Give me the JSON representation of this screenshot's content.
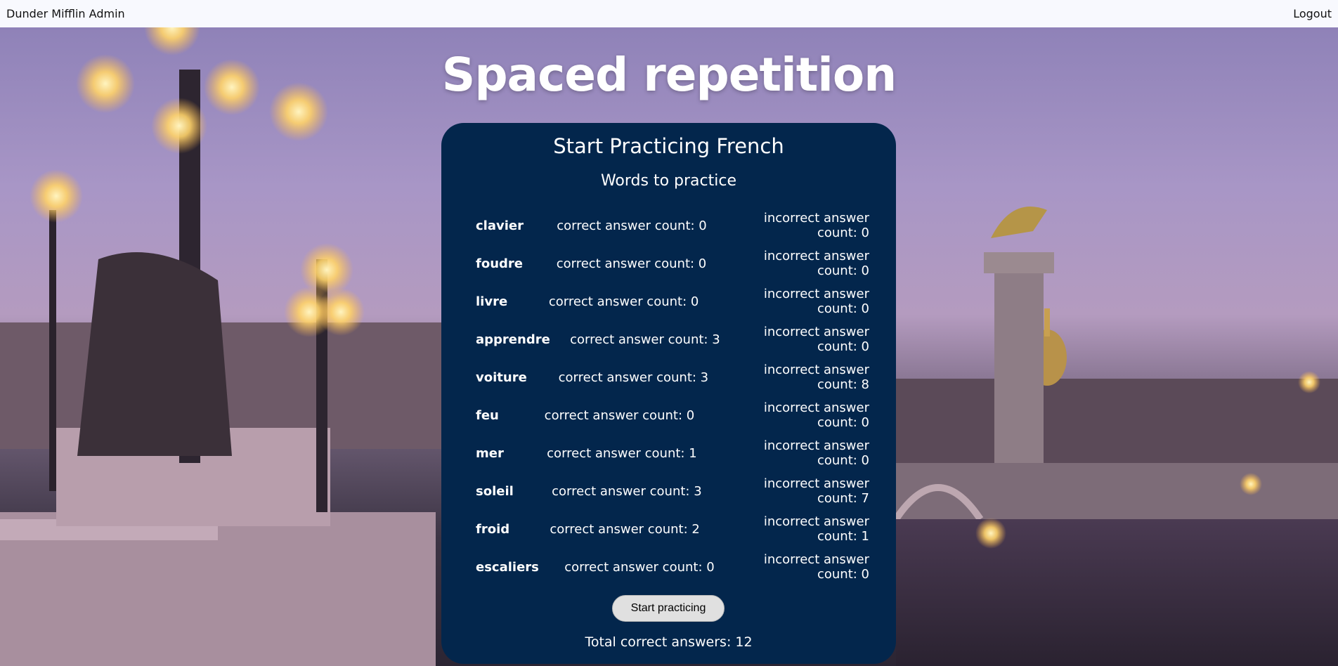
{
  "navbar": {
    "brand": "Dunder Mifflin Admin",
    "logout_label": "Logout"
  },
  "page": {
    "title": "Spaced repetition"
  },
  "card": {
    "heading": "Start Practicing French",
    "subheading": "Words to practice",
    "words": [
      {
        "word": "clavier",
        "correct": "correct answer count: 0",
        "incorrect": "incorrect answer count: 0"
      },
      {
        "word": "foudre",
        "correct": "correct answer count: 0",
        "incorrect": "incorrect answer count: 0"
      },
      {
        "word": "livre",
        "correct": "correct answer count: 0",
        "incorrect": "incorrect answer count: 0"
      },
      {
        "word": "apprendre",
        "correct": "correct answer count: 3",
        "incorrect": "incorrect answer count: 0"
      },
      {
        "word": "voiture",
        "correct": "correct answer count: 3",
        "incorrect": "incorrect answer count: 8"
      },
      {
        "word": "feu",
        "correct": "correct answer count: 0",
        "incorrect": "incorrect answer count: 0"
      },
      {
        "word": "mer",
        "correct": "correct answer count: 1",
        "incorrect": "incorrect answer count: 0"
      },
      {
        "word": "soleil",
        "correct": "correct answer count: 3",
        "incorrect": "incorrect answer count: 7"
      },
      {
        "word": "froid",
        "correct": "correct answer count: 2",
        "incorrect": "incorrect answer count: 1"
      },
      {
        "word": "escaliers",
        "correct": "correct answer count: 0",
        "incorrect": "incorrect answer count: 0"
      }
    ],
    "start_button_label": "Start practicing",
    "total_label": "Total correct answers: 12"
  },
  "colors": {
    "card_background": "#03264c",
    "navbar_background": "#f8f9fe",
    "button_background": "#e0e0e0"
  }
}
